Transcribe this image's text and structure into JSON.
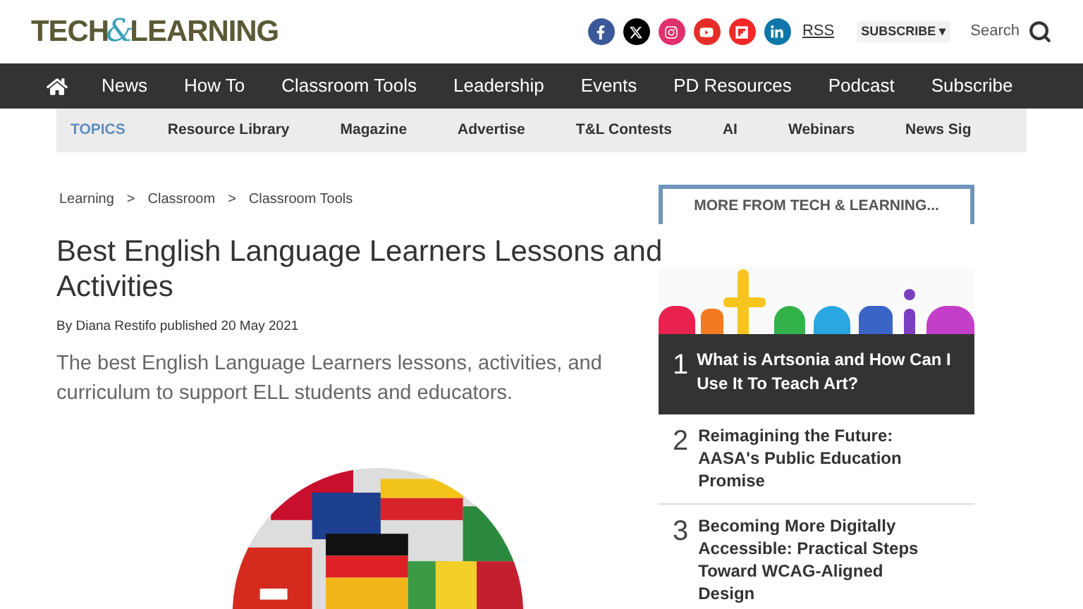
{
  "logo": {
    "part1": "TECH",
    "amp": "&",
    "part2": "LEARNING"
  },
  "social": [
    {
      "kind": "facebook",
      "color": "#3b5998"
    },
    {
      "kind": "x",
      "color": "#000000"
    },
    {
      "kind": "instagram",
      "color": "#e1306c"
    },
    {
      "kind": "youtube",
      "color": "#e52d27"
    },
    {
      "kind": "flipboard",
      "color": "#f52828"
    },
    {
      "kind": "linkedin",
      "color": "#0e76a8"
    }
  ],
  "rss": "RSS",
  "subscribe": "SUBSCRIBE",
  "subscribe_caret": "▾",
  "search": "Search",
  "nav": [
    "News",
    "How To",
    "Classroom Tools",
    "Leadership",
    "Events",
    "PD Resources",
    "Podcast",
    "Subscribe"
  ],
  "topics": {
    "label": "TOPICS",
    "items": [
      "Resource Library",
      "Magazine",
      "Advertise",
      "T&L Contests",
      "AI",
      "Webinars",
      "News Sig"
    ]
  },
  "breadcrumb": [
    "Learning",
    "Classroom",
    "Classroom Tools"
  ],
  "separator": ">",
  "article": {
    "title": "Best English Language Learners Lessons and Activities",
    "byline": "By Diana Restifo published 20 May 2021",
    "summary": "The best English Language Learners lessons, activities, and curriculum to support ELL students and educators."
  },
  "sidebar": {
    "heading": "MORE FROM TECH & LEARNING...",
    "items": [
      {
        "number": "1",
        "title": "What is Artsonia and How Can I Use It To Teach Art?",
        "kind": "featured"
      },
      {
        "number": "2",
        "title": "Reimagining the Future: AASA's Public Education Promise",
        "kind": "plain"
      },
      {
        "number": "3",
        "title": "Becoming More Digitally Accessible: Practical Steps Toward WCAG-Aligned Design",
        "kind": "plain"
      }
    ]
  }
}
